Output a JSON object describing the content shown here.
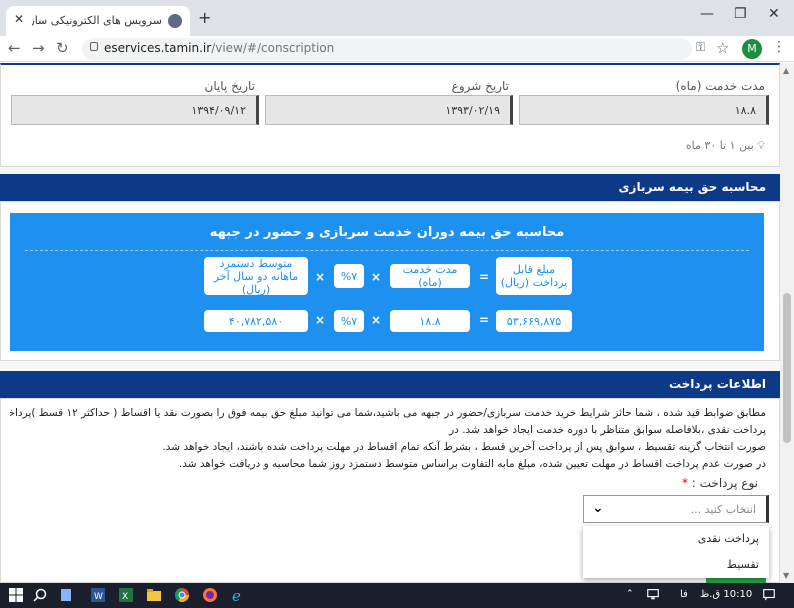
{
  "browser": {
    "tab_title": "سرویس های الکترونیکی سازمان تأم...",
    "tab_close": "✕",
    "new_tab": "+",
    "url_host": "eservices.tamin.ir",
    "url_path": "/view/#/conscription",
    "avatar_letter": "M",
    "win_minimize": "—",
    "win_restore": "❐",
    "win_close": "✕"
  },
  "service_period": {
    "duration_label": "مدت خدمت (ماه)",
    "duration_value": "۱۸.۸",
    "start_label": "تاریخ شروع",
    "start_value": "۱۳۹۳/۰۲/۱۹",
    "end_label": "تاریخ پایان",
    "end_value": "۱۳۹۴/۰۹/۱۲",
    "hint": "بین ۱ تا ۳۰ ماه"
  },
  "calc_section": {
    "header": "محاسبه حق بیمه سربازی",
    "title": "محاسبه حق بیمه دوران خدمت سربازی و حضور در جبهه",
    "headers": {
      "payable": "مبلغ قابل پرداخت (ریال)",
      "duration": "مدت خدمت (ماه)",
      "percent": "%۷",
      "avg_wage": "متوسط دستمزد ماهانه دو سال آخر (ریال)"
    },
    "values": {
      "payable": "۵۳,۶۶۹,۸۷۵",
      "duration": "۱۸.۸",
      "percent": "%۷",
      "avg_wage": "۴۰,۷۸۲,۵۸۰"
    },
    "ops": {
      "eq": "=",
      "mul": "×"
    }
  },
  "payment": {
    "header": "اطلاعات پرداخت",
    "paragraphs": [
      "مطابق ضوابط قید شده ، شما حائز شرایط خرید خدمت سربازی/حضور در جبهه می باشید،شما می توانید مبلغ حق بیمه فوق را بصورت نقد یا اقساط ( حداکثر ۱۲ قسط )پرداخت نمایید .در صورت",
      "پرداخت نقدی ،بلافاصله سوابق متناظر با دوره خدمت ایجاد خواهد شد. در",
      "صورت انتخاب گزینه تقسیط ، سوابق پس از پرداخت آخرین قسط ، بشرط آنکه تمام اقساط در مهلت پرداخت شده باشند، ایجاد خواهد شد.",
      "در صورت عدم پرداخت اقساط در مهلت تعیین شده، مبلغ مابه التفاوت براساس متوسط دستمزد روز شما محاسبه و دریافت خواهد شد."
    ],
    "type_label": "نوع پرداخت :",
    "required_mark": "*",
    "select_placeholder": "انتخاب کنید ...",
    "options": [
      "پرداخت نقدی",
      "تقسیط"
    ]
  },
  "taskbar": {
    "clock": "10:10 ق.ظ",
    "lang": "فا"
  },
  "colors": {
    "header_blue": "#0d3a86",
    "panel_blue": "#1e90f0",
    "taskbar": "#1a1f2b"
  }
}
